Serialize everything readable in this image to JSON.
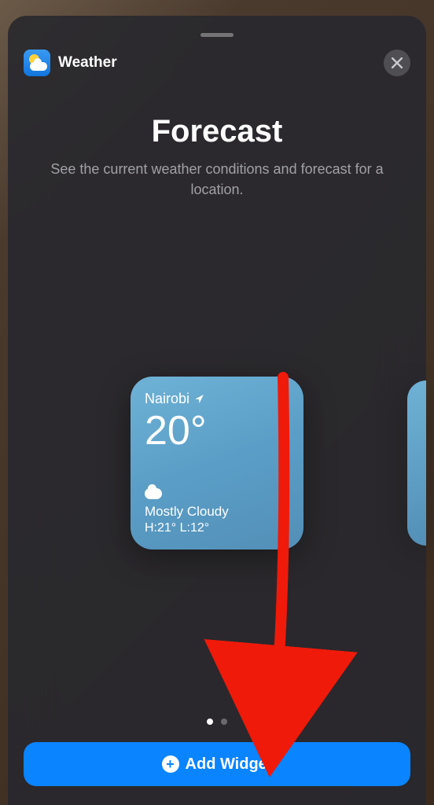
{
  "header": {
    "app_name": "Weather"
  },
  "title": "Forecast",
  "subtitle": "See the current weather conditions and forecast for a location.",
  "widget": {
    "location": "Nairobi",
    "temperature": "20°",
    "condition": "Mostly Cloudy",
    "high_low": "H:21° L:12°"
  },
  "pagination": {
    "total": 2,
    "active": 0
  },
  "add_button_label": "Add Widget"
}
